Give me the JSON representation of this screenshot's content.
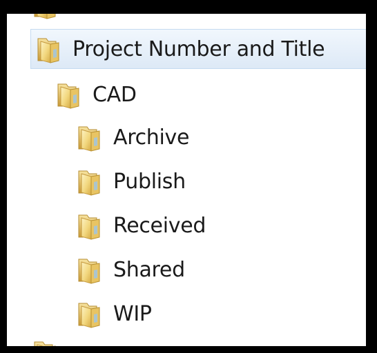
{
  "tree": {
    "root": {
      "label": "Project Number and Title",
      "icon": "folder-icon"
    },
    "child": {
      "label": "CAD",
      "icon": "folder-icon"
    },
    "subfolders": [
      {
        "label": "Archive",
        "icon": "folder-icon"
      },
      {
        "label": "Publish",
        "icon": "folder-icon"
      },
      {
        "label": "Received",
        "icon": "folder-icon"
      },
      {
        "label": "Shared",
        "icon": "folder-icon"
      },
      {
        "label": "WIP",
        "icon": "folder-icon"
      }
    ]
  },
  "colors": {
    "frame": "#000000",
    "panel": "#ffffff",
    "selection": "#dde9f6",
    "folder_light": "#fbe9a6",
    "folder_dark": "#d9b14a"
  }
}
